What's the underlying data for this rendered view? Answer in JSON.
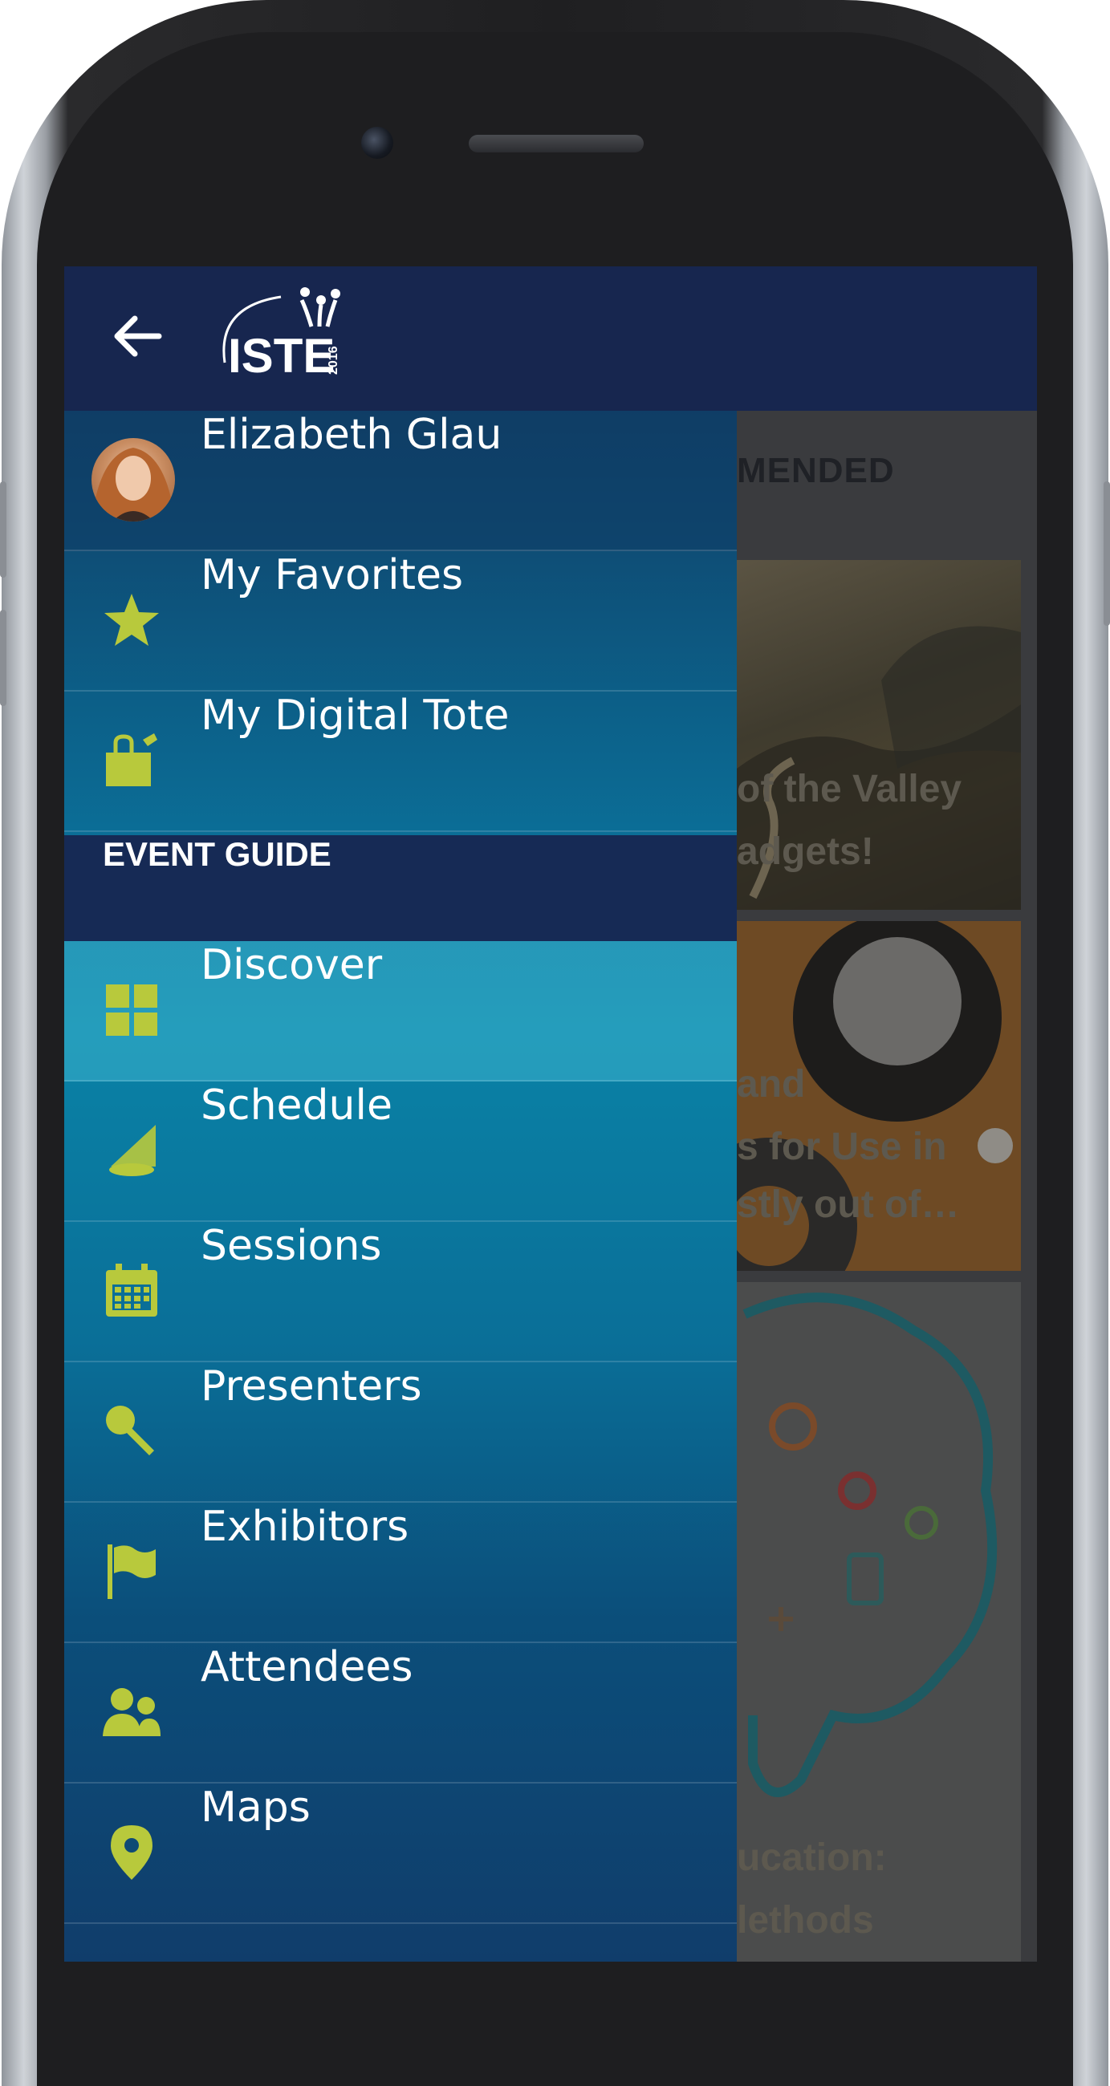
{
  "header": {
    "back_label": "",
    "logo_text": "ISTE",
    "logo_year": "2016"
  },
  "drawer": {
    "profile": {
      "name": "Elizabeth Glau"
    },
    "items_top": [
      {
        "label": "My Favorites",
        "icon": "star-icon"
      },
      {
        "label": "My Digital Tote",
        "icon": "tote-bag-icon"
      }
    ],
    "section_title": "EVENT GUIDE",
    "items": [
      {
        "label": "Discover",
        "icon": "grid-icon",
        "active": true
      },
      {
        "label": "Schedule",
        "icon": "schedule-icon"
      },
      {
        "label": "Sessions",
        "icon": "calendar-icon"
      },
      {
        "label": "Presenters",
        "icon": "microphone-icon"
      },
      {
        "label": "Exhibitors",
        "icon": "flag-icon"
      },
      {
        "label": "Attendees",
        "icon": "people-icon"
      },
      {
        "label": "Maps",
        "icon": "map-pin-icon"
      }
    ]
  },
  "background": {
    "section_label": "MENDED",
    "card1_lines": [
      "of the Valley",
      "adgets!"
    ],
    "card2_lines": [
      "and",
      "s for Use in",
      "stly out of…"
    ],
    "card3_lines": [
      "ucation:",
      "lethods"
    ]
  },
  "colors": {
    "topbar": "#17264f",
    "section_header": "#162a55",
    "icon_accent": "#b8c93c",
    "drawer_active": "#3aa6c0"
  }
}
